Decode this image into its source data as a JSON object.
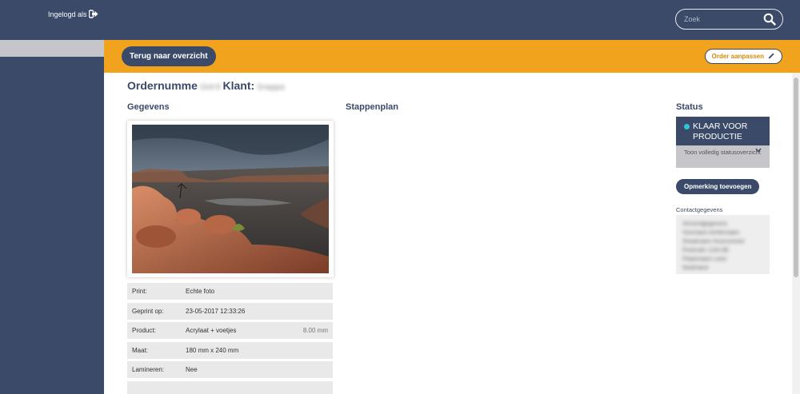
{
  "sidebar": {
    "logged_in_label": "Ingelogd als",
    "logout_icon": "logout-icon"
  },
  "header": {
    "search": {
      "placeholder": "Zoek",
      "value": "",
      "icon": "search-icon"
    }
  },
  "actionbar": {
    "back_label": "Terug naar overzicht",
    "edit_label": "Order aanpassen",
    "edit_icon": "pencil-icon"
  },
  "order": {
    "order_label": "Ordernumme",
    "order_number_redacted": "Ord-9",
    "client_label": "Klant:",
    "client_redacted": "Snappa"
  },
  "sections": {
    "details": "Gegevens",
    "plan": "Stappenplan",
    "status": "Status"
  },
  "details": [
    {
      "key": "Print:",
      "value": "Echte foto",
      "extra": ""
    },
    {
      "key": "Geprint op:",
      "value": "23-05-2017 12:33:26",
      "extra": ""
    },
    {
      "key": "Product:",
      "value": "Acrylaat + voetjes",
      "extra": "8.00 mm"
    },
    {
      "key": "Maat:",
      "value": "180 mm x 240 mm",
      "extra": ""
    },
    {
      "key": "Lamineren:",
      "value": "Nee",
      "extra": ""
    },
    {
      "key": "",
      "value": "",
      "extra": ""
    }
  ],
  "status": {
    "current": "KLAAR VOOR PRODUCTIE",
    "dot_color": "#2ec5d6",
    "toggle_label": "Toon volledig statusoverzicht",
    "remark_button": "Opmerking toevoegen",
    "contact_label": "Contactgegevens",
    "contact_lines_redacted": [
      "Verzendgegevens",
      "Voornaam Achternaam",
      "Straatnaam Huisnummer",
      "Postcode 1234 AB",
      "Plaatsnaam Land",
      "Nederland"
    ]
  },
  "colors": {
    "navy": "#3a4a68",
    "orange": "#f1a31d"
  }
}
